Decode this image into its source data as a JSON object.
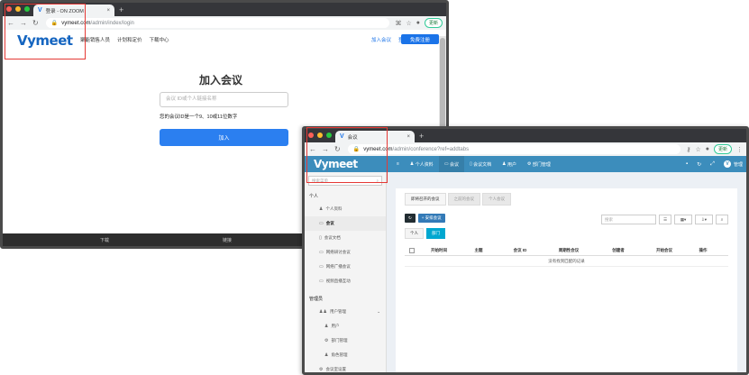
{
  "login_window": {
    "tab_title": "登录 - ON ZOOM",
    "url_host": "vymeet.com",
    "url_path": "/admin/index/login",
    "update_label": "更新",
    "logo": "Vymeet",
    "nav_links": [
      "聚能销售人员",
      "计划和定价",
      "下载中心"
    ],
    "right_links": [
      "加入会议",
      "登录"
    ],
    "register_button": "免费注册",
    "join_title": "加入会议",
    "join_placeholder": "会议 ID或个人链接名称",
    "join_hint": "您的会议ID是一个9、10或11位数字",
    "join_button": "加入",
    "footer_left": "下载",
    "footer_right": "链接"
  },
  "conference_window": {
    "tab_title": "会议",
    "url_host": "vymeet.com",
    "url_path": "/admin/conference?ref=addtabs",
    "update_label": "更新",
    "logo": "Vymeet",
    "menu": [
      "个人资料",
      "会议",
      "会议文档",
      "用户",
      "部门管理"
    ],
    "user_label": "管理",
    "sidebar": {
      "search_placeholder": "搜索菜单",
      "section_personal": "个人",
      "items_personal": [
        "个人资料",
        "会议",
        "会议文档",
        "网络研讨会议",
        "网络广播会议",
        "视频直播互动"
      ],
      "section_admin": "管理员",
      "items_admin": [
        "用户管理",
        "用户",
        "部门管理",
        "角色管理",
        "会议室设置"
      ]
    },
    "tabs": [
      "即将召开的会议",
      "之前的会议",
      "个人会议"
    ],
    "new_button": "+ 安排会议",
    "search_placeholder": "搜索",
    "filters": [
      "个人",
      "部门"
    ],
    "columns": [
      "开始时间",
      "主题",
      "会议 ID",
      "周期性会议",
      "创建者",
      "开始会议",
      "操作"
    ],
    "empty_text": "没有找到匹配的记录"
  },
  "colors": {
    "brand_blue": "#1565c0",
    "header_blue": "#3c8dbc",
    "button_blue": "#2b7ff0",
    "highlight_red": "#e53935"
  }
}
